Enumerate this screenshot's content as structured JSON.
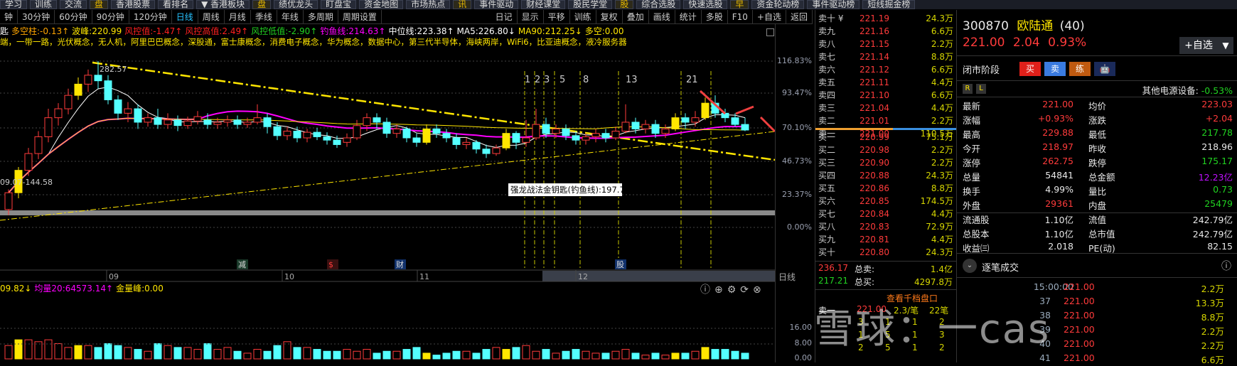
{
  "top_menu": [
    "学习",
    "训练",
    "交流",
    "盘",
    "香港股票",
    "看排名",
    "▼ 香港板块",
    "盘",
    "绩优龙头",
    "盯盘宝",
    "资金地图",
    "市场热点",
    "讯",
    "事件驱动",
    "财经课堂",
    "股民学堂",
    "股",
    "综合选股",
    "快速选股",
    "早",
    "资金轮动榜",
    "事件驱动榜",
    "短线掘金榜"
  ],
  "periods": [
    "钟",
    "30分钟",
    "60分钟",
    "90分钟",
    "120分钟",
    "日线",
    "周线",
    "月线",
    "季线",
    "年线",
    "多周期",
    "周期设置"
  ],
  "active_period": "日线",
  "tools": [
    "日记",
    "显示",
    "平移",
    "训练",
    "复权",
    "叠加",
    "画线",
    "统计",
    "多股",
    "F10",
    "+自选",
    "返回"
  ],
  "indicators": [
    {
      "text": "匙",
      "color": "#ffffff"
    },
    {
      "text": "多空柱:-0.13↑",
      "color": "#ffa500"
    },
    {
      "text": "波峰:220.99",
      "color": "#ffe600"
    },
    {
      "text": "风控值:-1.47↑",
      "color": "#ff2020"
    },
    {
      "text": "风控高值:2.49↑",
      "color": "#ff2020"
    },
    {
      "text": "风控低值:-2.90↑",
      "color": "#21d321"
    },
    {
      "text": "钓鱼线:214.63↑",
      "color": "#ff00ff"
    },
    {
      "text": "中位线:223.38↑",
      "color": "#ffffff"
    },
    {
      "text": "MA5:226.80↓",
      "color": "#ffffff"
    },
    {
      "text": "MA90:212.25↓",
      "color": "#ffe600"
    },
    {
      "text": "多空:0.00",
      "color": "#ffe600"
    }
  ],
  "concepts": "端，一带一路，光伏概念，无人机，阿里巴巴概念，深股通，富士康概念，消费电子概念，华为概念，数据中心，第三代半导体，海峡两岸，WiFi6，比亚迪概念，液冷服务器",
  "price_axis": [
    "116.83%",
    "93.47%",
    "70.10%",
    "46.73%",
    "23.37%",
    "0.00%"
  ],
  "high_label": "282.57",
  "low_label": "09.07-144.58",
  "tooltip": "强龙战法金钥匙(钓鱼线):197.72",
  "cycle_numbers": [
    "1",
    "2",
    "3",
    "5",
    "8",
    "13",
    "21"
  ],
  "event_tags": [
    "减",
    "$",
    "财",
    "股"
  ],
  "x_dates": [
    "09",
    "10",
    "11",
    "12"
  ],
  "period_label": "日线",
  "volume_header": [
    {
      "text": "09.82↓",
      "color": "#ffe600"
    },
    {
      "text": "均量20:64573.14↑",
      "color": "#ff00ff"
    },
    {
      "text": "金量峰:0.00",
      "color": "#ffe600"
    }
  ],
  "volume_axis": [
    "16.00",
    "8.00",
    "0.00"
  ],
  "chart_data": {
    "type": "candlestick",
    "fields": [
      "open",
      "close",
      "high",
      "low"
    ],
    "candles": [
      [
        150,
        165,
        168,
        145
      ],
      [
        165,
        185,
        188,
        160
      ],
      [
        185,
        200,
        205,
        180
      ],
      [
        200,
        215,
        220,
        195
      ],
      [
        215,
        232,
        240,
        210
      ],
      [
        232,
        240,
        245,
        225
      ],
      [
        240,
        252,
        258,
        235
      ],
      [
        252,
        262,
        268,
        248
      ],
      [
        262,
        270,
        275,
        255
      ],
      [
        270,
        265,
        282.57,
        258
      ],
      [
        265,
        248,
        270,
        244
      ],
      [
        248,
        236,
        252,
        230
      ],
      [
        236,
        240,
        246,
        228
      ],
      [
        240,
        228,
        244,
        222
      ],
      [
        228,
        232,
        236,
        224
      ],
      [
        232,
        226,
        240,
        222
      ],
      [
        226,
        230,
        236,
        222
      ],
      [
        230,
        225,
        234,
        220
      ],
      [
        225,
        229,
        233,
        222
      ],
      [
        229,
        233,
        238,
        226
      ],
      [
        230,
        226,
        236,
        222
      ],
      [
        226,
        228,
        232,
        222
      ],
      [
        228,
        230,
        234,
        224
      ],
      [
        230,
        226,
        234,
        222
      ],
      [
        226,
        228,
        232,
        223
      ],
      [
        228,
        232,
        244,
        226
      ],
      [
        232,
        224,
        236,
        218
      ],
      [
        224,
        216,
        228,
        212
      ],
      [
        216,
        220,
        224,
        212
      ],
      [
        220,
        214,
        224,
        210
      ],
      [
        214,
        219,
        222,
        210
      ],
      [
        219,
        215,
        223,
        212
      ],
      [
        215,
        212,
        219,
        208
      ],
      [
        212,
        208,
        216,
        205
      ],
      [
        210,
        214,
        218,
        206
      ],
      [
        214,
        225,
        230,
        212
      ],
      [
        225,
        232,
        236,
        220
      ],
      [
        232,
        228,
        236,
        222
      ],
      [
        228,
        218,
        232,
        214
      ],
      [
        218,
        222,
        226,
        214
      ],
      [
        222,
        214,
        224,
        210
      ],
      [
        214,
        210,
        218,
        206
      ],
      [
        210,
        222,
        226,
        208
      ],
      [
        222,
        218,
        226,
        214
      ],
      [
        218,
        214,
        222,
        210
      ],
      [
        214,
        208,
        218,
        204
      ],
      [
        208,
        210,
        214,
        204
      ],
      [
        210,
        204,
        212,
        200
      ],
      [
        204,
        200,
        208,
        196
      ],
      [
        200,
        205,
        208,
        198
      ],
      [
        205,
        218,
        222,
        203
      ],
      [
        218,
        210,
        220,
        204
      ],
      [
        210,
        214,
        230,
        206
      ],
      [
        214,
        226,
        240,
        212
      ],
      [
        226,
        218,
        232,
        214
      ],
      [
        218,
        222,
        226,
        214
      ],
      [
        222,
        216,
        226,
        212
      ],
      [
        216,
        212,
        220,
        208
      ],
      [
        212,
        215,
        218,
        208
      ],
      [
        215,
        218,
        222,
        210
      ],
      [
        218,
        214,
        222,
        210
      ],
      [
        214,
        220,
        224,
        212
      ],
      [
        220,
        228,
        244,
        218
      ],
      [
        228,
        222,
        232,
        218
      ],
      [
        222,
        226,
        230,
        218
      ],
      [
        226,
        218,
        230,
        214
      ],
      [
        218,
        222,
        226,
        214
      ],
      [
        222,
        232,
        236,
        220
      ],
      [
        232,
        228,
        236,
        222
      ],
      [
        228,
        232,
        238,
        224
      ],
      [
        232,
        245,
        250,
        230
      ],
      [
        245,
        236,
        252,
        232
      ],
      [
        236,
        232,
        240,
        228
      ],
      [
        232,
        226,
        236,
        224
      ],
      [
        226,
        221,
        232,
        220
      ]
    ],
    "highlight_candles": [
      1,
      7,
      42,
      50,
      67,
      70
    ],
    "volumes": [
      7,
      10,
      10,
      9,
      10,
      8,
      6,
      7,
      7,
      6,
      8,
      7,
      6,
      5,
      4,
      8,
      7,
      6,
      6,
      5,
      8,
      5,
      6,
      4,
      3,
      5,
      4,
      7,
      9,
      6,
      6,
      5,
      4,
      4,
      5,
      4,
      5,
      3,
      4,
      4,
      5,
      6,
      3,
      2,
      3,
      4,
      4,
      3,
      5,
      6,
      5,
      6,
      7,
      4,
      5,
      3,
      4,
      5,
      4,
      3,
      3,
      4,
      5,
      3,
      2,
      3,
      2,
      3,
      3,
      4,
      6,
      5,
      5,
      4,
      3
    ],
    "ylim_price": [
      144.58,
      282.57
    ],
    "volume_ylim": [
      0,
      16
    ]
  },
  "orderbook": {
    "asks": [
      [
        "卖十 ¥",
        "221.19",
        "24.3万"
      ],
      [
        "卖九",
        "221.16",
        "6.6万"
      ],
      [
        "卖八",
        "221.15",
        "2.2万"
      ],
      [
        "卖七",
        "221.14",
        "8.8万"
      ],
      [
        "卖六",
        "221.12",
        "6.6万"
      ],
      [
        "卖五",
        "221.11",
        "4.4万"
      ],
      [
        "卖四",
        "221.10",
        "6.6万"
      ],
      [
        "卖三",
        "221.04",
        "4.4万"
      ],
      [
        "卖二",
        "221.01",
        "2.2万"
      ],
      [
        "卖一",
        "221.00",
        "110.5万"
      ]
    ],
    "bids": [
      [
        "买一",
        "220.99",
        "75.1万"
      ],
      [
        "买二",
        "220.98",
        "2.2万"
      ],
      [
        "买三",
        "220.90",
        "2.2万"
      ],
      [
        "买四",
        "220.88",
        "24.3万"
      ],
      [
        "买五",
        "220.86",
        "8.8万"
      ],
      [
        "买六",
        "220.85",
        "174.5万"
      ],
      [
        "买七",
        "220.84",
        "4.4万"
      ],
      [
        "买八",
        "220.83",
        "72.9万"
      ],
      [
        "买九",
        "220.81",
        "4.4万"
      ],
      [
        "买十",
        "220.80",
        "24.3万"
      ]
    ],
    "ask_avg_label": "卖均:",
    "ask_avg": "236.17",
    "total_ask_label": "总卖:",
    "total_ask": "1.4亿",
    "bid_avg_label": "买均:",
    "bid_avg": "217.21",
    "total_bid_label": "总买:",
    "total_bid": "4297.8万",
    "depth_link": "查看千档盘口",
    "sell1_label": "卖一",
    "sell1_price": "221.00",
    "sell1_per": "2.3/笔",
    "sell1_count": "22笔",
    "queue": [
      [
        "3",
        "1",
        "1",
        "2"
      ],
      [
        "1",
        "5",
        "1",
        "3"
      ],
      [
        "2",
        "5",
        "1",
        "2"
      ]
    ]
  },
  "quote": {
    "code": "300870",
    "name": "欧陆通",
    "count": "(40)",
    "price": "221.00",
    "change": "2.04",
    "pct": "0.93%",
    "watch_button": "+自选",
    "status": "闭市阶段",
    "buy": "买",
    "sell": "卖",
    "practice": "练",
    "rl": [
      "R",
      "L"
    ],
    "sector": "其他电源设备:",
    "sector_pct": "-0.53%",
    "stats": [
      [
        "最新",
        "221.00",
        "red",
        "均价",
        "223.03",
        "red"
      ],
      [
        "涨幅",
        "+0.93%",
        "red",
        "涨跌",
        "+2.04",
        "red"
      ],
      [
        "最高",
        "229.88",
        "red",
        "最低",
        "217.78",
        "grn"
      ],
      [
        "今开",
        "218.97",
        "red",
        "昨收",
        "218.96",
        "wht"
      ],
      [
        "涨停",
        "262.75",
        "red",
        "跌停",
        "175.17",
        "grn"
      ],
      [
        "总量",
        "54841",
        "wht",
        "总金额",
        "12.23亿",
        "pur"
      ],
      [
        "换手",
        "4.99%",
        "wht",
        "量比",
        "0.73",
        "grn"
      ],
      [
        "外盘",
        "29361",
        "red",
        "内盘",
        "25479",
        "grn"
      ],
      [
        "流通股",
        "1.10亿",
        "wht",
        "流值",
        "242.79亿",
        "wht"
      ],
      [
        "总股本",
        "1.10亿",
        "wht",
        "总市值",
        "242.79亿",
        "wht"
      ],
      [
        "收益㈢",
        "2.018",
        "wht",
        "PE(动)",
        "82.15",
        "wht"
      ]
    ],
    "ticks_title": "逐笔成交",
    "ticks": [
      [
        "15:00:00",
        "221.00",
        "2.2万"
      ],
      [
        "37",
        "221.00",
        "13.3万"
      ],
      [
        "38",
        "221.00",
        "8.8万"
      ],
      [
        "39",
        "221.00",
        "2.2万"
      ],
      [
        "40",
        "221.00",
        "2.2万"
      ],
      [
        "41",
        "221.00",
        "6.6万"
      ]
    ]
  },
  "watermark": "雪球：一cas",
  "colors": {
    "up": "#ff3b3b",
    "down": "#54ffff",
    "special": "#ffe600",
    "ma5": "#ffffff",
    "ma20": "#ff00ff",
    "ma60": "#ffe600",
    "bg": "#000000"
  }
}
